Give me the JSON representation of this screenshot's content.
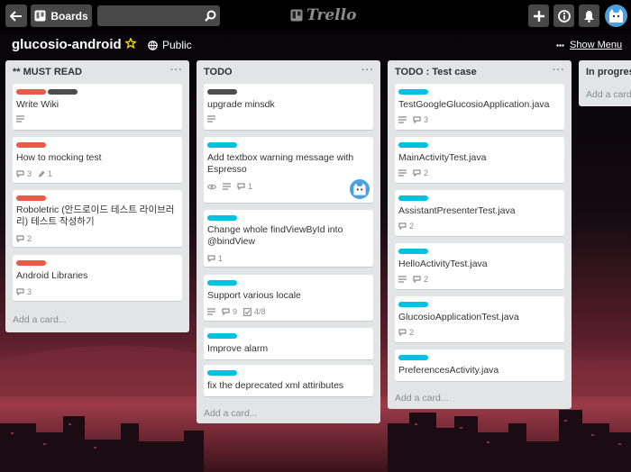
{
  "header": {
    "boards_label": "Boards",
    "search_value": "",
    "logo_text": "Trello"
  },
  "board": {
    "title": "glucosio-android",
    "visibility": "Public",
    "menu_label": "Show Menu"
  },
  "colors": {
    "red": "#eb5a46",
    "black": "#4d4d4d",
    "sky": "#00c2e0",
    "list_bg": "#e2e4e6"
  },
  "lists": [
    {
      "title": "** MUST READ",
      "add_card": "Add a card...",
      "cards": [
        {
          "title": "Write Wiki",
          "labels": [
            "red",
            "black"
          ],
          "badges": {
            "description": true
          }
        },
        {
          "title": "How to mocking test",
          "labels": [
            "red"
          ],
          "badges": {
            "comments": "3",
            "attachments": "1"
          }
        },
        {
          "title": "Roboletric (안드로이드 테스트 라이브러리) 테스트 작성하기",
          "labels": [
            "red"
          ],
          "badges": {
            "comments": "2"
          }
        },
        {
          "title": "Android Libraries",
          "labels": [
            "red"
          ],
          "badges": {
            "comments": "3"
          }
        }
      ]
    },
    {
      "title": "TODO",
      "add_card": "Add a card...",
      "cards": [
        {
          "title": "upgrade minsdk",
          "labels": [
            "black"
          ],
          "badges": {
            "description": true
          }
        },
        {
          "title": "Add textbox warning message with Espresso",
          "labels": [
            "sky"
          ],
          "badges": {
            "watch": true,
            "description": true,
            "comments": "1"
          },
          "member": "cat-avatar"
        },
        {
          "title": "Change whole findViewById into @bindView",
          "labels": [
            "sky"
          ],
          "badges": {
            "comments": "1"
          }
        },
        {
          "title": "Support various locale",
          "labels": [
            "sky"
          ],
          "badges": {
            "description": true,
            "comments": "9",
            "checklist": "4/8"
          }
        },
        {
          "title": "Improve alarm",
          "labels": [
            "sky"
          ],
          "badges": {}
        },
        {
          "title": "fix the deprecated xml attiributes",
          "labels": [
            "sky"
          ],
          "badges": {}
        }
      ]
    },
    {
      "title": "TODO : Test case",
      "add_card": "Add a card...",
      "cards": [
        {
          "title": "TestGoogleGlucosioApplication.java",
          "labels": [
            "sky"
          ],
          "badges": {
            "description": true,
            "comments": "3"
          }
        },
        {
          "title": "MainActivityTest.java",
          "labels": [
            "sky"
          ],
          "badges": {
            "description": true,
            "comments": "2"
          }
        },
        {
          "title": "AssistantPresenterTest.java",
          "labels": [
            "sky"
          ],
          "badges": {
            "comments": "2"
          }
        },
        {
          "title": "HelloActivityTest.java",
          "labels": [
            "sky"
          ],
          "badges": {
            "description": true,
            "comments": "2"
          }
        },
        {
          "title": "GlucosioApplicationTest.java",
          "labels": [
            "sky"
          ],
          "badges": {
            "comments": "2"
          }
        },
        {
          "title": "PreferencesActivity.java",
          "labels": [
            "sky"
          ],
          "badges": {}
        }
      ]
    },
    {
      "title": "In progress",
      "add_card": "Add a card...",
      "cards": []
    }
  ]
}
